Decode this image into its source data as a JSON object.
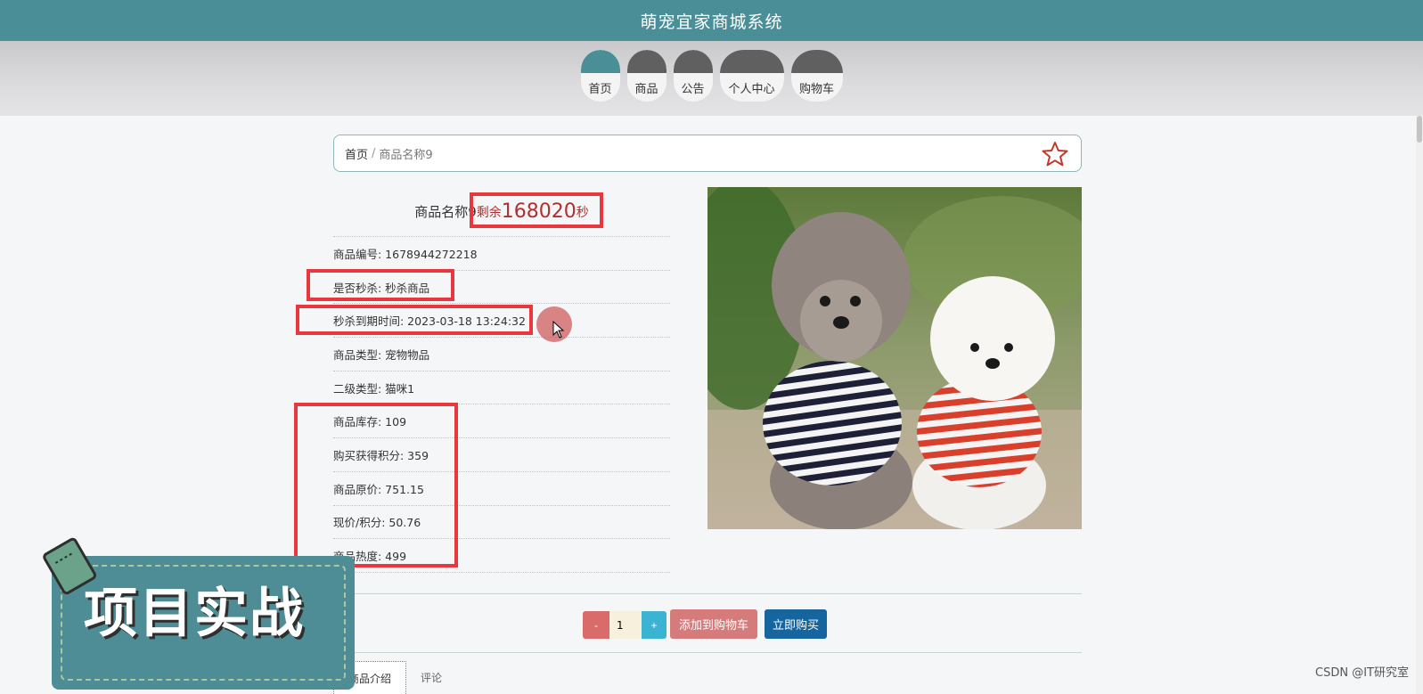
{
  "app": {
    "title": "萌宠宜家商城系统"
  },
  "nav": [
    {
      "label": "首页",
      "active": true
    },
    {
      "label": "商品"
    },
    {
      "label": "公告"
    },
    {
      "label": "个人中心"
    },
    {
      "label": "购物车"
    }
  ],
  "breadcrumb": {
    "home": "首页",
    "sep": "/",
    "current": "商品名称9"
  },
  "product": {
    "name": "商品名称9",
    "countdown_prefix": "剩余",
    "countdown_value": "168020",
    "countdown_unit": "秒",
    "fields": [
      "商品编号: 1678944272218",
      "是否秒杀: 秒杀商品",
      "秒杀到期时间: 2023-03-18 13:24:32",
      "商品类型: 宠物物品",
      "二级类型: 猫咪1",
      "商品库存: 109",
      "购买获得积分: 359",
      "商品原价: 751.15",
      "现价/积分: 50.76",
      "商品热度: 499"
    ]
  },
  "actions": {
    "minus": "-",
    "quantity": "1",
    "plus": "+",
    "add_to_cart": "添加到购物车",
    "buy_now": "立即购买"
  },
  "tabs": [
    "商品介绍",
    "评论"
  ],
  "overlay": {
    "badge_text": "项目实战",
    "watermark": "CSDN @IT研究室"
  },
  "colors": {
    "header": "#4a8f97",
    "accent_red": "#e8383e",
    "buy_blue": "#17659e"
  }
}
